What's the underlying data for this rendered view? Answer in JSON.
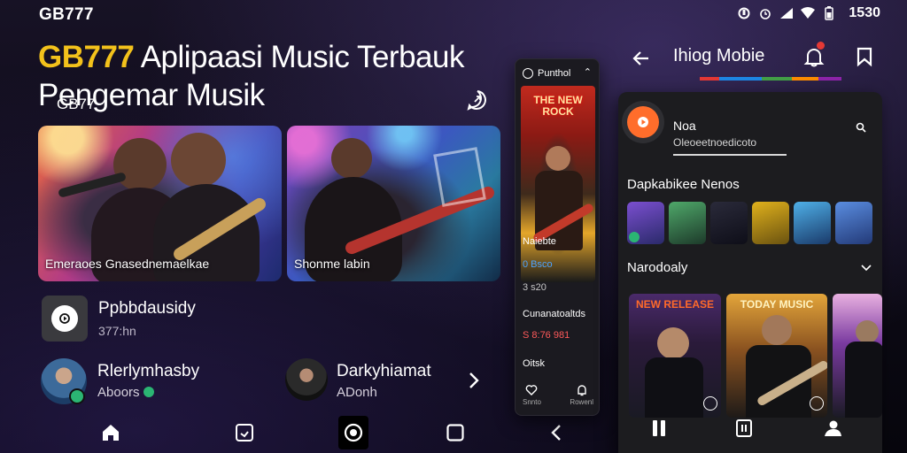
{
  "status_bar": {
    "brand": "GB777",
    "time": "1530"
  },
  "hero": {
    "brand": "GB777",
    "title_rest": " Aplipaasi Music Terbauk",
    "title_line2": "Pengemar Musik"
  },
  "cards": [
    {
      "caption": "Emeraoes Gnasednemaelkae"
    },
    {
      "caption": "Shonme labin"
    }
  ],
  "podcast_row": {
    "title": "Ppbbdausidy",
    "subtitle": "377:hn"
  },
  "artists": [
    {
      "name": "Rlerlymhasby",
      "sub": "Aboors"
    },
    {
      "name": "Darkyhiamat",
      "sub": "ADonh"
    }
  ],
  "middle_panel": {
    "header": "Punthol",
    "poster_title": "THE NEW ROCK",
    "items": [
      {
        "text": "Naiebte",
        "color": "#ffffff"
      },
      {
        "text": "0 Bsco",
        "color": "#4da3ff"
      },
      {
        "text": "3 s20",
        "color": "#c7c7c7"
      },
      {
        "text": "Cunanatoaltds",
        "color": "#ffffff"
      },
      {
        "text": "S 8:76 981",
        "color": "#ff5a5a"
      },
      {
        "text": "Oitsk",
        "color": "#ffffff"
      }
    ],
    "bottom_labels": [
      "Snnto",
      "Rowenl"
    ]
  },
  "right_panel": {
    "title": "Ihiog Mobie",
    "section_label": "GB77",
    "profile_name": "Noa",
    "profile_desc": "Oleoeetnoedicoto",
    "section_artists": "Dapkabikee Nenos",
    "section_recent": "Narodoaly",
    "album_titles": [
      "NEW RELEASE",
      "TODAY MUSIC"
    ],
    "accent_colors": [
      "#e53935",
      "#1e88e5",
      "#43a047",
      "#fb8c00",
      "#8e24aa"
    ]
  },
  "icons": {
    "status": [
      "alarm-icon",
      "signal-icon",
      "wifi-icon",
      "battery-icon"
    ],
    "bottom_nav": [
      "home-icon",
      "library-icon",
      "disc-icon",
      "square-icon",
      "back-icon"
    ]
  }
}
